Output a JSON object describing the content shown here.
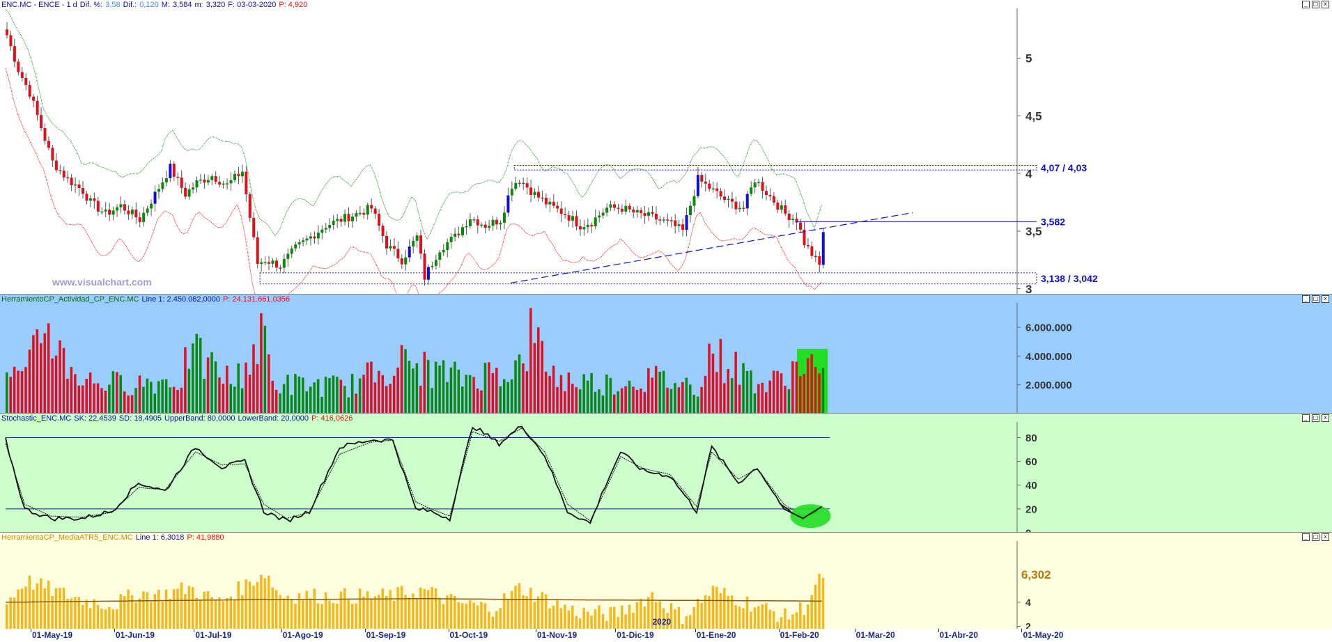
{
  "colors": {
    "price_bg": "#ffffff",
    "vol_bg": "#99ccff",
    "stoch_bg": "#ccffcc",
    "atr_bg": "#ffffe0",
    "up": "#0a8a0a",
    "down": "#e0101a",
    "strong_up": "#1010d0",
    "atr_bar": "#f5b81c",
    "level": "#1010c8",
    "upper_band": "#1b8a1b",
    "lower_band": "#e01010"
  },
  "price_panel": {
    "header": [
      {
        "text": "ENC.MC - ENCE -  1 d",
        "color": "#1010a0"
      },
      {
        "text": "Dif. %:",
        "color": "#1010a0"
      },
      {
        "text": "3,58",
        "color": "#3a8ae0"
      },
      {
        "text": "Dif.:",
        "color": "#1010a0"
      },
      {
        "text": "0,120",
        "color": "#3a8ae0"
      },
      {
        "text": "M:",
        "color": "#1010a0"
      },
      {
        "text": "3,584",
        "color": "#1010a0"
      },
      {
        "text": "m:",
        "color": "#1010a0"
      },
      {
        "text": "3,320",
        "color": "#1010a0"
      },
      {
        "text": "F: 03-03-2020",
        "color": "#1010a0"
      },
      {
        "text": "P: 4,920",
        "color": "#e01010"
      }
    ],
    "y_ticks": [
      "5",
      "4,5",
      "4",
      "3,5",
      "3"
    ],
    "y_tick_values": [
      5,
      4.5,
      4,
      3.5,
      3
    ],
    "y_range": [
      2.95,
      5.42
    ],
    "watermark": "www.visualchart.com",
    "levels": [
      {
        "label": "4,07 / 4,03",
        "top": 4.07,
        "bottom": 4.03
      },
      {
        "label": "3,582",
        "value": 3.582
      },
      {
        "label": "3,138 / 3,042",
        "top": 3.138,
        "bottom": 3.042
      }
    ],
    "trendline": {
      "from": [
        133,
        3.05
      ],
      "to": [
        229,
        3.66
      ]
    }
  },
  "volume_panel": {
    "header": [
      {
        "text": "HerramientoCP_Actividad_CP_ENC.MC",
        "color": "#0a6a0a"
      },
      {
        "text": "Line 1: 2.450.082,0000",
        "color": "#1010a0"
      },
      {
        "text": "P: 24.131.661,0356",
        "color": "#e01010"
      }
    ],
    "y_ticks": [
      "6.000.000",
      "4.000.000",
      "2.000.000"
    ],
    "y_tick_values": [
      6000000,
      4000000,
      2000000
    ],
    "y_range": [
      0,
      7600000
    ]
  },
  "stoch_panel": {
    "header": [
      {
        "text": "Stochastic_ENC.MC",
        "color": "#1010a0"
      },
      {
        "text": "SK: 22,4539",
        "color": "#1010a0"
      },
      {
        "text": "SD: 18,4905",
        "color": "#1010a0"
      },
      {
        "text": "UpperBand: 80,0000",
        "color": "#1010a0"
      },
      {
        "text": "LowerBand: 20,0000",
        "color": "#1010a0"
      },
      {
        "text": "P: 416,0626",
        "color": "#e01010"
      }
    ],
    "y_ticks": [
      "80",
      "60",
      "40",
      "20",
      "0"
    ],
    "y_tick_values": [
      80,
      60,
      40,
      20,
      0
    ],
    "y_range": [
      0,
      92
    ],
    "upper_band": 80,
    "lower_band": 20
  },
  "atr_panel": {
    "header": [
      {
        "text": "HerramientaCP_MediaATR5_ENC.MC",
        "color": "#d08a00"
      },
      {
        "text": "Line 1: 6,3018",
        "color": "#1010a0"
      },
      {
        "text": "P: 41,9880",
        "color": "#e01010"
      }
    ],
    "y_ticks": [
      "4",
      "2"
    ],
    "y_tick_values": [
      4,
      2
    ],
    "y_range": [
      1.8,
      9.2
    ],
    "last_value": "6,302",
    "year_marker": "2020"
  },
  "x_axis": {
    "labels": [
      "01-May-19",
      "01-Jun-19",
      "01-Jul-19",
      "01-Ago-19",
      "01-Sep-19",
      "01-Oct-19",
      "01-Nov-19",
      "01-Dic-19",
      "01-Ene-20",
      "01-Feb-20",
      "01-Mar-20",
      "01-Abr-20",
      "01-May-20"
    ],
    "label_bar_index": [
      0,
      22,
      43,
      66,
      88,
      110,
      133,
      154,
      175,
      197,
      217,
      239,
      261
    ]
  },
  "window_buttons": [
    "_",
    "□",
    "x"
  ],
  "chart_data": [
    {
      "type": "candlestick",
      "title": "ENC.MC - ENCE - 1 d",
      "x_labels": [
        "01-May-19",
        "01-Jun-19",
        "01-Jul-19",
        "01-Ago-19",
        "01-Sep-19",
        "01-Oct-19",
        "01-Nov-19",
        "01-Dic-19",
        "01-Ene-20",
        "01-Feb-20",
        "01-Mar-20"
      ],
      "anchor_bar_index": [
        0,
        3,
        6,
        9,
        12,
        16,
        20,
        22,
        26,
        30,
        35,
        39,
        43,
        47,
        50,
        54,
        58,
        62,
        66,
        68,
        72,
        76,
        80,
        84,
        88,
        92,
        96,
        100,
        104,
        108,
        110,
        114,
        118,
        122,
        126,
        130,
        133,
        135,
        139,
        143,
        147,
        151,
        154,
        158,
        162,
        166,
        170,
        175,
        178,
        182,
        186,
        190,
        194,
        197,
        201,
        205,
        208,
        210,
        212,
        214,
        215
      ],
      "anchor_close": [
        5.2,
        4.9,
        4.7,
        4.4,
        4.1,
        3.95,
        3.85,
        3.75,
        3.65,
        3.72,
        3.6,
        3.82,
        4.05,
        3.82,
        3.92,
        3.98,
        3.9,
        4.02,
        3.22,
        3.25,
        3.2,
        3.35,
        3.45,
        3.55,
        3.6,
        3.65,
        3.7,
        3.38,
        3.25,
        3.45,
        3.1,
        3.35,
        3.45,
        3.62,
        3.55,
        3.6,
        3.9,
        3.95,
        3.82,
        3.72,
        3.65,
        3.55,
        3.58,
        3.7,
        3.7,
        3.65,
        3.62,
        3.56,
        3.5,
        3.95,
        3.85,
        3.75,
        3.7,
        3.95,
        3.8,
        3.65,
        3.6,
        3.4,
        3.3,
        3.2,
        3.5
      ],
      "band_offset": 0.32,
      "y_range": [
        2.95,
        5.42
      ]
    },
    {
      "type": "bar",
      "title": "HerramientoCP_Actividad_CP_ENC.MC",
      "anchor_bar_index": [
        0,
        5,
        10,
        15,
        20,
        30,
        46,
        48,
        60,
        68,
        70,
        90,
        103,
        120,
        136,
        138,
        145,
        160,
        170,
        182,
        185,
        200,
        205,
        209,
        212,
        215
      ],
      "anchor_volume": [
        3000000,
        2500000,
        6800000,
        4000000,
        2500000,
        2200000,
        2500000,
        4500000,
        2300000,
        5800000,
        2200000,
        2000000,
        3800000,
        2600000,
        3500000,
        5800000,
        2500000,
        2200000,
        2600000,
        2000000,
        4500000,
        2000000,
        2800000,
        3600000,
        3600000,
        2450000
      ],
      "highlight_last_bars": 7,
      "y_range": [
        0,
        7600000
      ]
    },
    {
      "type": "line",
      "title": "Stochastic_ENC.MC",
      "series": [
        {
          "name": "SK",
          "anchor_bar_index": [
            0,
            5,
            12,
            20,
            28,
            35,
            42,
            50,
            57,
            63,
            68,
            74,
            80,
            88,
            96,
            102,
            108,
            112,
            117,
            123,
            130,
            136,
            142,
            148,
            154,
            158,
            162,
            168,
            175,
            182,
            186,
            193,
            198,
            205,
            210,
            215
          ],
          "values": [
            78,
            20,
            12,
            12,
            18,
            42,
            35,
            72,
            55,
            60,
            18,
            10,
            18,
            72,
            78,
            78,
            20,
            18,
            12,
            90,
            75,
            90,
            65,
            18,
            8,
            40,
            68,
            52,
            48,
            18,
            72,
            42,
            55,
            20,
            12,
            22
          ]
        },
        {
          "name": "SD",
          "anchor_bar_index": [
            0,
            5,
            12,
            20,
            28,
            35,
            42,
            50,
            57,
            63,
            68,
            74,
            80,
            88,
            96,
            102,
            108,
            112,
            117,
            123,
            130,
            136,
            142,
            148,
            154,
            158,
            162,
            168,
            175,
            182,
            186,
            193,
            198,
            205,
            210,
            215
          ],
          "values": [
            75,
            24,
            14,
            13,
            17,
            38,
            36,
            68,
            57,
            58,
            24,
            12,
            17,
            66,
            76,
            78,
            26,
            20,
            14,
            85,
            77,
            88,
            68,
            24,
            10,
            36,
            64,
            54,
            49,
            22,
            68,
            45,
            54,
            24,
            14,
            18
          ]
        }
      ],
      "bands": [
        80,
        20
      ],
      "y_range": [
        0,
        92
      ]
    },
    {
      "type": "bar",
      "title": "HerramientaCP_MediaATR5_ENC.MC",
      "anchor_bar_index": [
        0,
        5,
        12,
        20,
        28,
        35,
        40,
        48,
        56,
        68,
        72,
        85,
        100,
        110,
        118,
        128,
        135,
        150,
        160,
        170,
        178,
        186,
        195,
        205,
        210,
        215
      ],
      "anchor_atr": [
        4.0,
        5.8,
        5.0,
        4.2,
        3.8,
        4.8,
        4.6,
        5.2,
        4.0,
        6.5,
        4.6,
        4.5,
        4.5,
        5.0,
        4.0,
        3.5,
        5.2,
        3.2,
        3.0,
        4.6,
        2.8,
        5.0,
        4.0,
        2.8,
        3.6,
        6.3
      ],
      "average_line": {
        "anchor_bar_index": [
          0,
          60,
          110,
          150,
          215
        ],
        "values": [
          4.0,
          4.2,
          4.3,
          4.2,
          4.1
        ]
      },
      "y_range": [
        1.8,
        9.2
      ]
    }
  ]
}
